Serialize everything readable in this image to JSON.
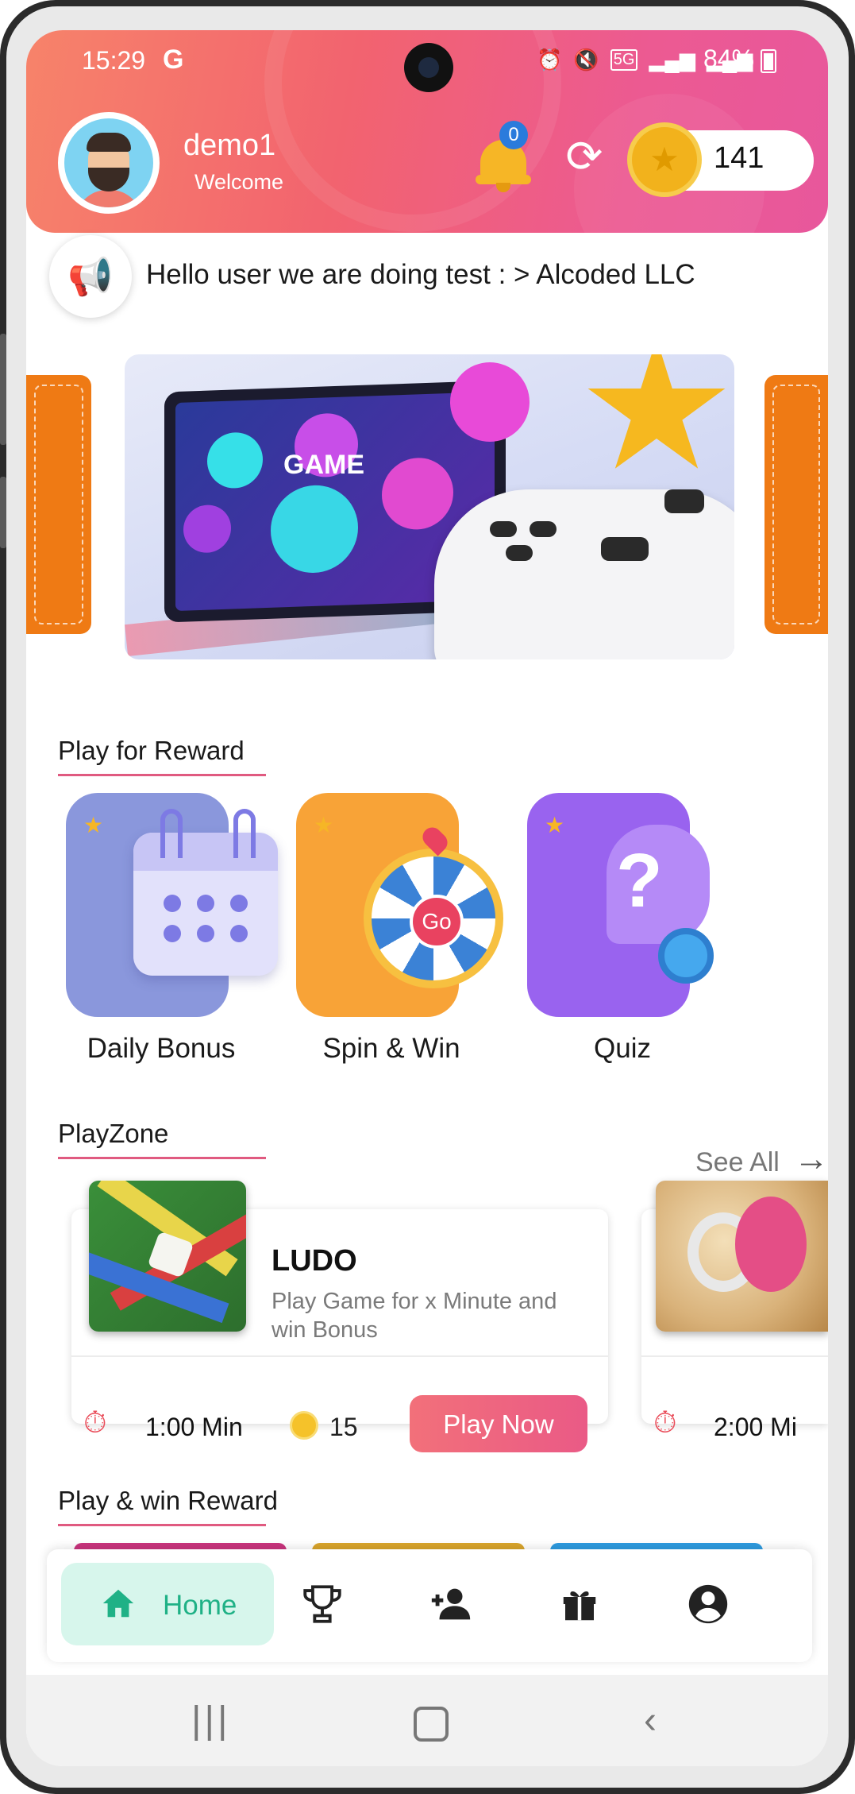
{
  "status_bar": {
    "time": "15:29",
    "carrier_glyph": "G",
    "battery": "84%",
    "icons": [
      "alarm-icon",
      "mute-icon",
      "5g-icon",
      "signal-icon",
      "signal-icon"
    ]
  },
  "header": {
    "username": "demo1",
    "greeting": "Welcome",
    "notification_count": "0",
    "coins": "141"
  },
  "announcement": {
    "text": "Hello user we are doing test : > Alcoded LLC"
  },
  "banner": {
    "label": "GAME"
  },
  "play_for_reward": {
    "title": "Play for Reward",
    "items": [
      {
        "label": "Daily Bonus",
        "icon": "calendar-icon",
        "color": "#8a97dc"
      },
      {
        "label": "Spin & Win",
        "icon": "wheel-icon",
        "color": "#f8a337"
      },
      {
        "label": "Quiz",
        "icon": "quiz-icon",
        "color": "#9963ef"
      }
    ]
  },
  "playzone": {
    "title": "PlayZone",
    "see_all": "See All",
    "games": [
      {
        "title": "LUDO",
        "description": "Play Game for x Minute and win Bonus",
        "time": "1:00 Min",
        "coins": "15",
        "button": "Play Now"
      },
      {
        "time": "2:00 Mi"
      }
    ]
  },
  "play_and_win": {
    "title": "Play & win Reward"
  },
  "bottom_nav": {
    "items": [
      {
        "label": "Home",
        "icon": "home-icon",
        "active": true
      },
      {
        "label": "",
        "icon": "trophy-icon"
      },
      {
        "label": "",
        "icon": "add-friend-icon"
      },
      {
        "label": "",
        "icon": "gift-icon"
      },
      {
        "label": "",
        "icon": "profile-icon"
      }
    ]
  },
  "colors": {
    "header_gradient_start": "#f7836a",
    "header_gradient_end": "#e8579c",
    "accent_pink": "#ea5a86",
    "accent_green": "#1fb186"
  }
}
